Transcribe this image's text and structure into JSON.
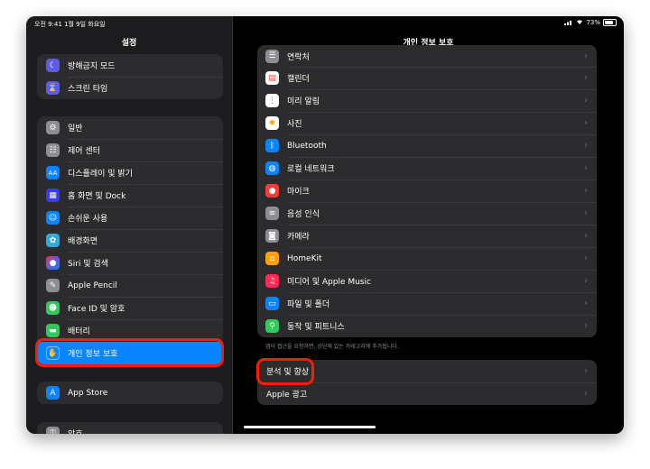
{
  "status": {
    "time": "오전 9:41  1월 9일 화요일",
    "battery": "73%"
  },
  "sidebar": {
    "title": "설정",
    "group1": [
      {
        "label": "방해금지 모드",
        "icon": "moon-icon",
        "glyph": "☾",
        "color": "#5e5ce6"
      },
      {
        "label": "스크린 타임",
        "icon": "hourglass-icon",
        "glyph": "⌛",
        "color": "#5e5ce6"
      }
    ],
    "group2": [
      {
        "label": "일반",
        "icon": "gear-icon",
        "glyph": "⚙",
        "color": "#8e8e93"
      },
      {
        "label": "제어 센터",
        "icon": "toggles-icon",
        "glyph": "☷",
        "color": "#8e8e93"
      },
      {
        "label": "디스플레이 및 밝기",
        "icon": "display-aa-icon",
        "glyph": "AA",
        "color": "#0a84ff"
      },
      {
        "label": "홈 화면 및 Dock",
        "icon": "home-grid-icon",
        "glyph": "▦",
        "color": "#3a3aff"
      },
      {
        "label": "손쉬운 사용",
        "icon": "accessibility-icon",
        "glyph": "☺",
        "color": "#0a84ff"
      },
      {
        "label": "배경화면",
        "icon": "wallpaper-flower-icon",
        "glyph": "✿",
        "color": "#34aadc"
      },
      {
        "label": "Siri 및 검색",
        "icon": "siri-icon",
        "glyph": "●",
        "color": "#3b2b8f"
      },
      {
        "label": "Apple Pencil",
        "icon": "pencil-icon",
        "glyph": "✎",
        "color": "#8e8e93"
      },
      {
        "label": "Face ID 및 암호",
        "icon": "faceid-icon",
        "glyph": "☻",
        "color": "#34c759"
      },
      {
        "label": "배터리",
        "icon": "battery-icon",
        "glyph": "▬",
        "color": "#34c759"
      },
      {
        "label": "개인 정보 보호",
        "icon": "hand-icon",
        "glyph": "✋",
        "color": "#0a84ff"
      }
    ],
    "group3": [
      {
        "label": "App Store",
        "icon": "appstore-icon",
        "glyph": "A",
        "color": "#0a84ff"
      }
    ],
    "group4": [
      {
        "label": "암호",
        "icon": "key-icon",
        "glyph": "⚿",
        "color": "#8e8e93"
      }
    ]
  },
  "main": {
    "title": "개인 정보 보호",
    "list": [
      {
        "label": "연락처",
        "icon": "contacts-icon",
        "glyph": "☰",
        "color": "#8e8e93"
      },
      {
        "label": "캘린더",
        "icon": "calendar-icon",
        "glyph": "▤",
        "color": "#ffffff"
      },
      {
        "label": "미리 알림",
        "icon": "reminders-icon",
        "glyph": "⋮",
        "color": "#ffffff"
      },
      {
        "label": "사진",
        "icon": "photos-icon",
        "glyph": "✺",
        "color": "#ffffff"
      },
      {
        "label": "Bluetooth",
        "icon": "bluetooth-icon",
        "glyph": "ᛒ",
        "color": "#0a84ff"
      },
      {
        "label": "로컬 네트워크",
        "icon": "globe-icon",
        "glyph": "◍",
        "color": "#0a84ff"
      },
      {
        "label": "마이크",
        "icon": "microphone-icon",
        "glyph": "🎙",
        "color": "#ff3b30"
      },
      {
        "label": "음성 인식",
        "icon": "waveform-icon",
        "glyph": "≋",
        "color": "#8e8e93"
      },
      {
        "label": "카메라",
        "icon": "camera-icon",
        "glyph": "◙",
        "color": "#8e8e93"
      },
      {
        "label": "HomeKit",
        "icon": "home-icon",
        "glyph": "⌂",
        "color": "#ff9f0a"
      },
      {
        "label": "미디어 및 Apple Music",
        "icon": "music-icon",
        "glyph": "♫",
        "color": "#ff2d55"
      },
      {
        "label": "파일 및 폴더",
        "icon": "folder-icon",
        "glyph": "▭",
        "color": "#0a84ff"
      },
      {
        "label": "동작 및 피트니스",
        "icon": "fitness-icon",
        "glyph": "🏃",
        "color": "#34c759"
      }
    ],
    "note": "앱이 접근을 요청하면, 상단에 있는 카테고리에 추가됩니다.",
    "list2": [
      {
        "label": "분석 및 향상"
      },
      {
        "label": "Apple 광고"
      }
    ]
  },
  "chevron": "›"
}
